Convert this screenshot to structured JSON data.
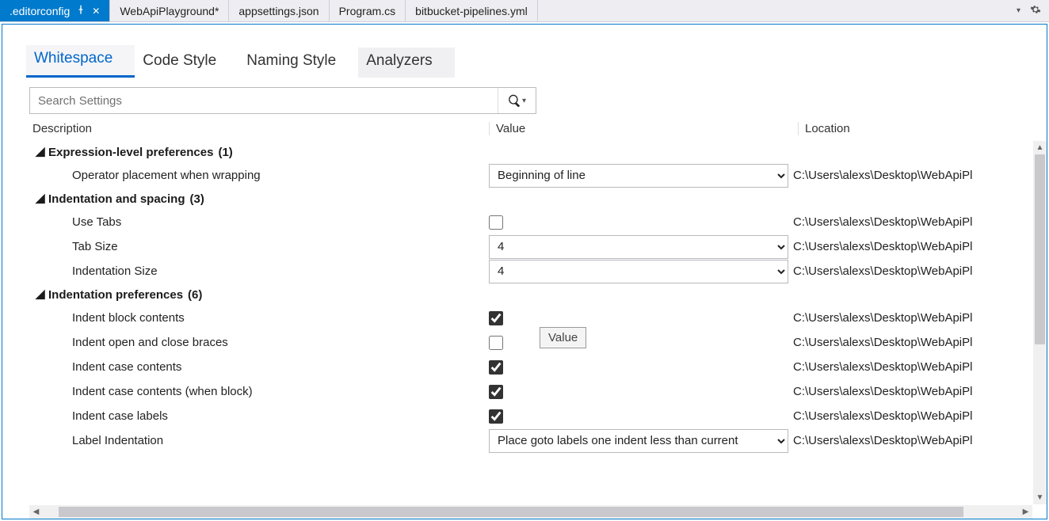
{
  "tabs": {
    "docs": [
      {
        "label": ".editorconfig",
        "active": true,
        "pinned": true,
        "closable": true
      },
      {
        "label": "WebApiPlayground*"
      },
      {
        "label": "appsettings.json"
      },
      {
        "label": "Program.cs"
      },
      {
        "label": "bitbucket-pipelines.yml"
      }
    ]
  },
  "inner_tabs": [
    "Whitespace",
    "Code Style",
    "Naming Style",
    "Analyzers"
  ],
  "inner_tab_active": 0,
  "search": {
    "placeholder": "Search Settings"
  },
  "columns": {
    "description": "Description",
    "value": "Value",
    "location": "Location"
  },
  "tooltip": "Value",
  "location_path": "C:\\Users\\alexs\\Desktop\\WebApiPl",
  "groups": [
    {
      "title": "Expression-level preferences",
      "count": "(1)",
      "rows": [
        {
          "desc": "Operator placement when wrapping",
          "type": "combo",
          "value": "Beginning of line",
          "loc": true
        }
      ]
    },
    {
      "title": "Indentation and spacing",
      "count": "(3)",
      "rows": [
        {
          "desc": "Use Tabs",
          "type": "check",
          "checked": false,
          "loc": true
        },
        {
          "desc": "Tab Size",
          "type": "combo",
          "value": "4",
          "loc": true
        },
        {
          "desc": "Indentation Size",
          "type": "combo",
          "value": "4",
          "loc": true
        }
      ]
    },
    {
      "title": "Indentation preferences",
      "count": "(6)",
      "rows": [
        {
          "desc": "Indent block contents",
          "type": "check",
          "checked": true,
          "loc": true
        },
        {
          "desc": "Indent open and close braces",
          "type": "check",
          "checked": false,
          "loc": true
        },
        {
          "desc": "Indent case contents",
          "type": "check",
          "checked": true,
          "loc": true
        },
        {
          "desc": "Indent case contents (when block)",
          "type": "check",
          "checked": true,
          "loc": true
        },
        {
          "desc": "Indent case labels",
          "type": "check",
          "checked": true,
          "loc": true
        },
        {
          "desc": "Label Indentation",
          "type": "combo",
          "value": "Place goto labels one indent less than current",
          "loc": true
        }
      ]
    }
  ]
}
